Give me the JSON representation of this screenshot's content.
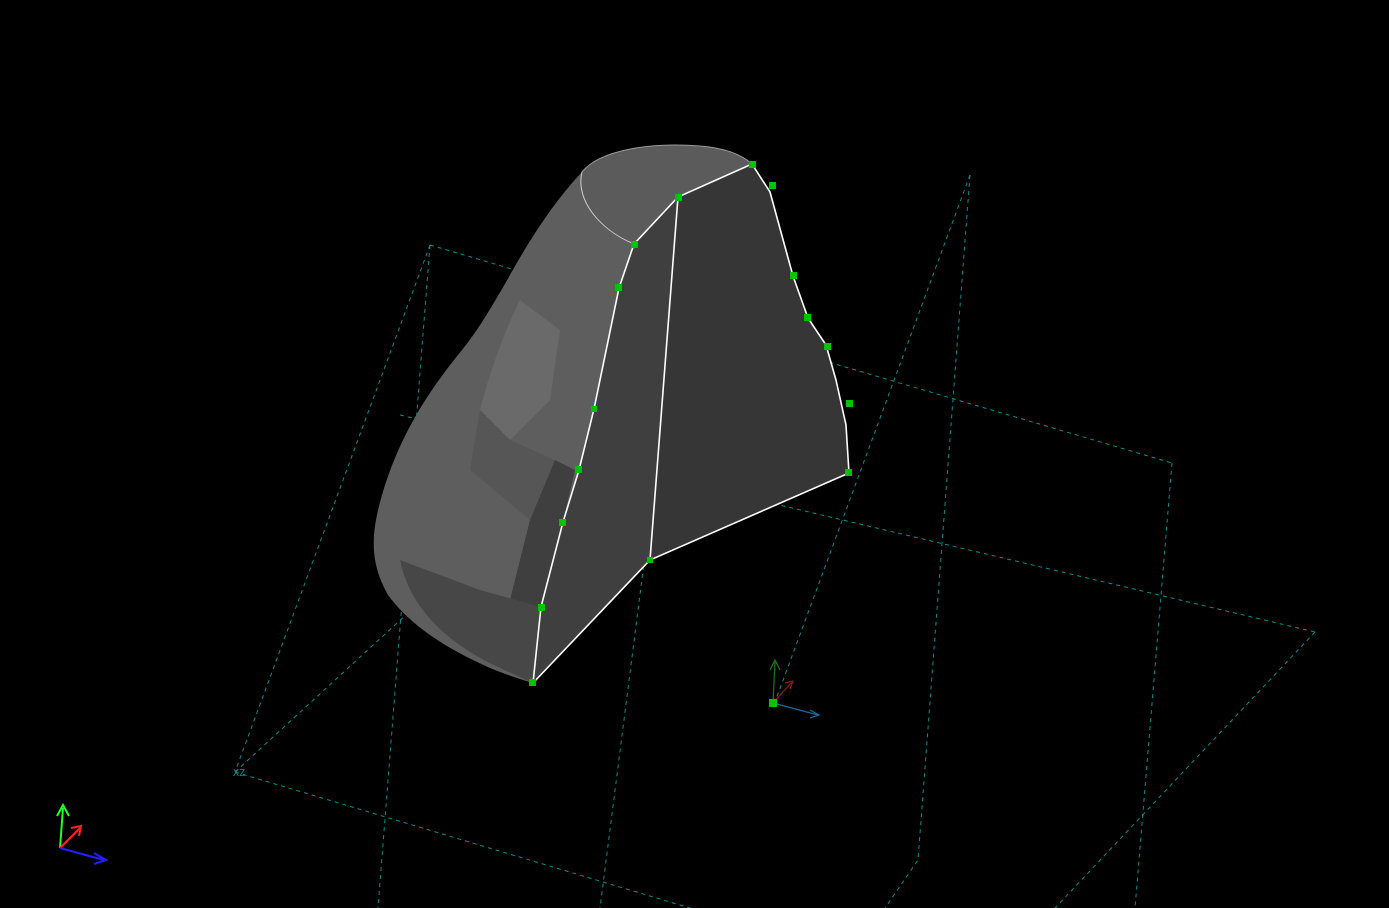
{
  "viewport": {
    "background": "#000000",
    "grid_plane_label": "XZ"
  },
  "colors": {
    "grid": "#0aa5a5",
    "vertex": "#00c400",
    "edge": "#ffffff",
    "axis_x": "#ff2020",
    "axis_y": "#20ff20",
    "axis_z": "#2020ff",
    "gizmo_x": "#8a1a1a",
    "gizmo_y": "#1a7a1a",
    "gizmo_z": "#1a6a9a"
  },
  "icons": [
    "view-axis-triad-icon",
    "pivot-gizmo-icon"
  ]
}
